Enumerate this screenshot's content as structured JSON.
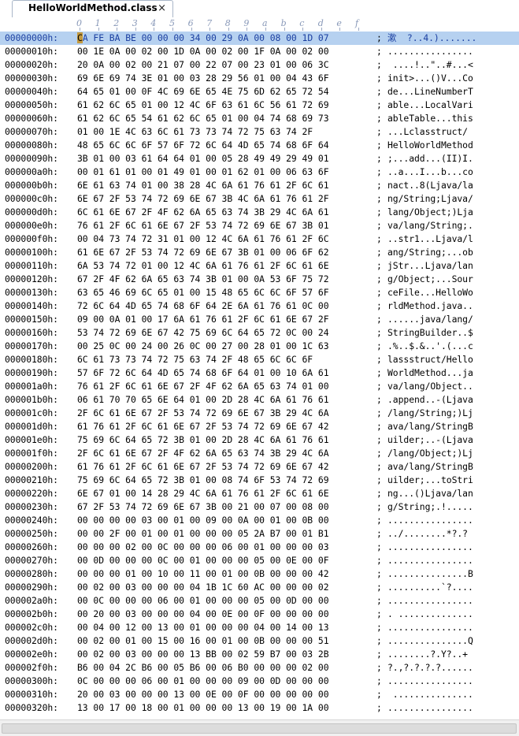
{
  "tab": {
    "title": "HelloWorldMethod.class",
    "close": "×"
  },
  "ruler": [
    "0",
    "1",
    "2",
    "3",
    "4",
    "5",
    "6",
    "7",
    "8",
    "9",
    "a",
    "b",
    "c",
    "d",
    "e",
    "f"
  ],
  "rows": [
    {
      "addr": "00000000h:",
      "bytes": "CA FE BA BE 00 00 00 34 00 29 0A 00 08 00 1D 07",
      "ascii": "漱  ?..4.)......."
    },
    {
      "addr": "00000010h:",
      "bytes": "00 1E 0A 00 02 00 1D 0A 00 02 00 1F 0A 00 02 00",
      "ascii": "................"
    },
    {
      "addr": "00000020h:",
      "bytes": "20 0A 00 02 00 21 07 00 22 07 00 23 01 00 06 3C",
      "ascii": " ....!..\"..#...<"
    },
    {
      "addr": "00000030h:",
      "bytes": "69 6E 69 74 3E 01 00 03 28 29 56 01 00 04 43 6F",
      "ascii": "init>...()V...Co"
    },
    {
      "addr": "00000040h:",
      "bytes": "64 65 01 00 0F 4C 69 6E 65 4E 75 6D 62 65 72 54",
      "ascii": "de...LineNumberT"
    },
    {
      "addr": "00000050h:",
      "bytes": "61 62 6C 65 01 00 12 4C 6F 63 61 6C 56 61 72 69",
      "ascii": "able...LocalVari"
    },
    {
      "addr": "00000060h:",
      "bytes": "61 62 6C 65 54 61 62 6C 65 01 00 04 74 68 69 73",
      "ascii": "ableTable...this"
    },
    {
      "addr": "00000070h:",
      "bytes": "01 00 1E 4C 63 6C 61 73 73 74 72 75 63 74 2F",
      "ascii": "...Lclasstruct/"
    },
    {
      "addr": "00000080h:",
      "bytes": "48 65 6C 6C 6F 57 6F 72 6C 64 4D 65 74 68 6F 64",
      "ascii": "HelloWorldMethod"
    },
    {
      "addr": "00000090h:",
      "bytes": "3B 01 00 03 61 64 64 01 00 05 28 49 49 29 49 01",
      "ascii": ";...add...(II)I."
    },
    {
      "addr": "000000a0h:",
      "bytes": "00 01 61 01 00 01 49 01 00 01 62 01 00 06 63 6F",
      "ascii": "..a...I...b...co"
    },
    {
      "addr": "000000b0h:",
      "bytes": "6E 61 63 74 01 00 38 28 4C 6A 61 76 61 2F 6C 61",
      "ascii": "nact..8(Ljava/la"
    },
    {
      "addr": "000000c0h:",
      "bytes": "6E 67 2F 53 74 72 69 6E 67 3B 4C 6A 61 76 61 2F",
      "ascii": "ng/String;Ljava/"
    },
    {
      "addr": "000000d0h:",
      "bytes": "6C 61 6E 67 2F 4F 62 6A 65 63 74 3B 29 4C 6A 61",
      "ascii": "lang/Object;)Lja"
    },
    {
      "addr": "000000e0h:",
      "bytes": "76 61 2F 6C 61 6E 67 2F 53 74 72 69 6E 67 3B 01",
      "ascii": "va/lang/String;."
    },
    {
      "addr": "000000f0h:",
      "bytes": "00 04 73 74 72 31 01 00 12 4C 6A 61 76 61 2F 6C",
      "ascii": "..str1...Ljava/l"
    },
    {
      "addr": "00000100h:",
      "bytes": "61 6E 67 2F 53 74 72 69 6E 67 3B 01 00 06 6F 62",
      "ascii": "ang/String;...ob"
    },
    {
      "addr": "00000110h:",
      "bytes": "6A 53 74 72 01 00 12 4C 6A 61 76 61 2F 6C 61 6E",
      "ascii": "jStr...Ljava/lan"
    },
    {
      "addr": "00000120h:",
      "bytes": "67 2F 4F 62 6A 65 63 74 3B 01 00 0A 53 6F 75 72",
      "ascii": "g/Object;...Sour"
    },
    {
      "addr": "00000130h:",
      "bytes": "63 65 46 69 6C 65 01 00 15 48 65 6C 6C 6F 57 6F",
      "ascii": "ceFile...HelloWo"
    },
    {
      "addr": "00000140h:",
      "bytes": "72 6C 64 4D 65 74 68 6F 64 2E 6A 61 76 61 0C 00",
      "ascii": "rldMethod.java.."
    },
    {
      "addr": "00000150h:",
      "bytes": "09 00 0A 01 00 17 6A 61 76 61 2F 6C 61 6E 67 2F",
      "ascii": "......java/lang/"
    },
    {
      "addr": "00000160h:",
      "bytes": "53 74 72 69 6E 67 42 75 69 6C 64 65 72 0C 00 24",
      "ascii": "StringBuilder..$"
    },
    {
      "addr": "00000170h:",
      "bytes": "00 25 0C 00 24 00 26 0C 00 27 00 28 01 00 1C 63",
      "ascii": ".%..$.&..'.(...c"
    },
    {
      "addr": "00000180h:",
      "bytes": "6C 61 73 73 74 72 75 63 74 2F 48 65 6C 6C 6F",
      "ascii": "lassstruct/Hello"
    },
    {
      "addr": "00000190h:",
      "bytes": "57 6F 72 6C 64 4D 65 74 68 6F 64 01 00 10 6A 61",
      "ascii": "WorldMethod...ja"
    },
    {
      "addr": "000001a0h:",
      "bytes": "76 61 2F 6C 61 6E 67 2F 4F 62 6A 65 63 74 01 00",
      "ascii": "va/lang/Object.."
    },
    {
      "addr": "000001b0h:",
      "bytes": "06 61 70 70 65 6E 64 01 00 2D 28 4C 6A 61 76 61",
      "ascii": ".append..-(Ljava"
    },
    {
      "addr": "000001c0h:",
      "bytes": "2F 6C 61 6E 67 2F 53 74 72 69 6E 67 3B 29 4C 6A",
      "ascii": "/lang/String;)Lj"
    },
    {
      "addr": "000001d0h:",
      "bytes": "61 76 61 2F 6C 61 6E 67 2F 53 74 72 69 6E 67 42",
      "ascii": "ava/lang/StringB"
    },
    {
      "addr": "000001e0h:",
      "bytes": "75 69 6C 64 65 72 3B 01 00 2D 28 4C 6A 61 76 61",
      "ascii": "uilder;..-(Ljava"
    },
    {
      "addr": "000001f0h:",
      "bytes": "2F 6C 61 6E 67 2F 4F 62 6A 65 63 74 3B 29 4C 6A",
      "ascii": "/lang/Object;)Lj"
    },
    {
      "addr": "00000200h:",
      "bytes": "61 76 61 2F 6C 61 6E 67 2F 53 74 72 69 6E 67 42",
      "ascii": "ava/lang/StringB"
    },
    {
      "addr": "00000210h:",
      "bytes": "75 69 6C 64 65 72 3B 01 00 08 74 6F 53 74 72 69",
      "ascii": "uilder;...toStri"
    },
    {
      "addr": "00000220h:",
      "bytes": "6E 67 01 00 14 28 29 4C 6A 61 76 61 2F 6C 61 6E",
      "ascii": "ng...()Ljava/lan"
    },
    {
      "addr": "00000230h:",
      "bytes": "67 2F 53 74 72 69 6E 67 3B 00 21 00 07 00 08 00",
      "ascii": "g/String;.!....."
    },
    {
      "addr": "00000240h:",
      "bytes": "00 00 00 00 03 00 01 00 09 00 0A 00 01 00 0B 00",
      "ascii": "................"
    },
    {
      "addr": "00000250h:",
      "bytes": "00 00 2F 00 01 00 01 00 00 00 05 2A B7 00 01 B1",
      "ascii": "../........*?.?"
    },
    {
      "addr": "00000260h:",
      "bytes": "00 00 00 02 00 0C 00 00 00 06 00 01 00 00 00 03",
      "ascii": "................"
    },
    {
      "addr": "00000270h:",
      "bytes": "00 0D 00 00 00 0C 00 01 00 00 00 05 00 0E 00 0F",
      "ascii": "................"
    },
    {
      "addr": "00000280h:",
      "bytes": "00 00 00 01 00 10 00 11 00 01 00 0B 00 00 00 42",
      "ascii": "...............B"
    },
    {
      "addr": "00000290h:",
      "bytes": "00 02 00 03 00 00 00 04 1B 1C 60 AC 00 00 00 02",
      "ascii": "..........`?...."
    },
    {
      "addr": "000002a0h:",
      "bytes": "00 0C 00 00 00 06 00 01 00 00 00 05 00 0D 00 00",
      "ascii": "................"
    },
    {
      "addr": "000002b0h:",
      "bytes": "00 20 00 03 00 00 00 04 00 0E 00 0F 00 00 00 00",
      "ascii": ". .............."
    },
    {
      "addr": "000002c0h:",
      "bytes": "00 04 00 12 00 13 00 01 00 00 00 04 00 14 00 13",
      "ascii": "................"
    },
    {
      "addr": "000002d0h:",
      "bytes": "00 02 00 01 00 15 00 16 00 01 00 0B 00 00 00 51",
      "ascii": "...............Q"
    },
    {
      "addr": "000002e0h:",
      "bytes": "00 02 00 03 00 00 00 13 BB 00 02 59 B7 00 03 2B",
      "ascii": "........?.Y?..+"
    },
    {
      "addr": "000002f0h:",
      "bytes": "B6 00 04 2C B6 00 05 B6 00 06 B0 00 00 00 02 00",
      "ascii": "?.,?.?.?.?......"
    },
    {
      "addr": "00000300h:",
      "bytes": "0C 00 00 00 06 00 01 00 00 00 09 00 0D 00 00 00",
      "ascii": "................"
    },
    {
      "addr": "00000310h:",
      "bytes": "20 00 03 00 00 00 13 00 0E 00 0F 00 00 00 00 00",
      "ascii": " ..............."
    },
    {
      "addr": "00000320h:",
      "bytes": "13 00 17 00 18 00 01 00 00 00 13 00 19 00 1A 00",
      "ascii": "................"
    }
  ]
}
